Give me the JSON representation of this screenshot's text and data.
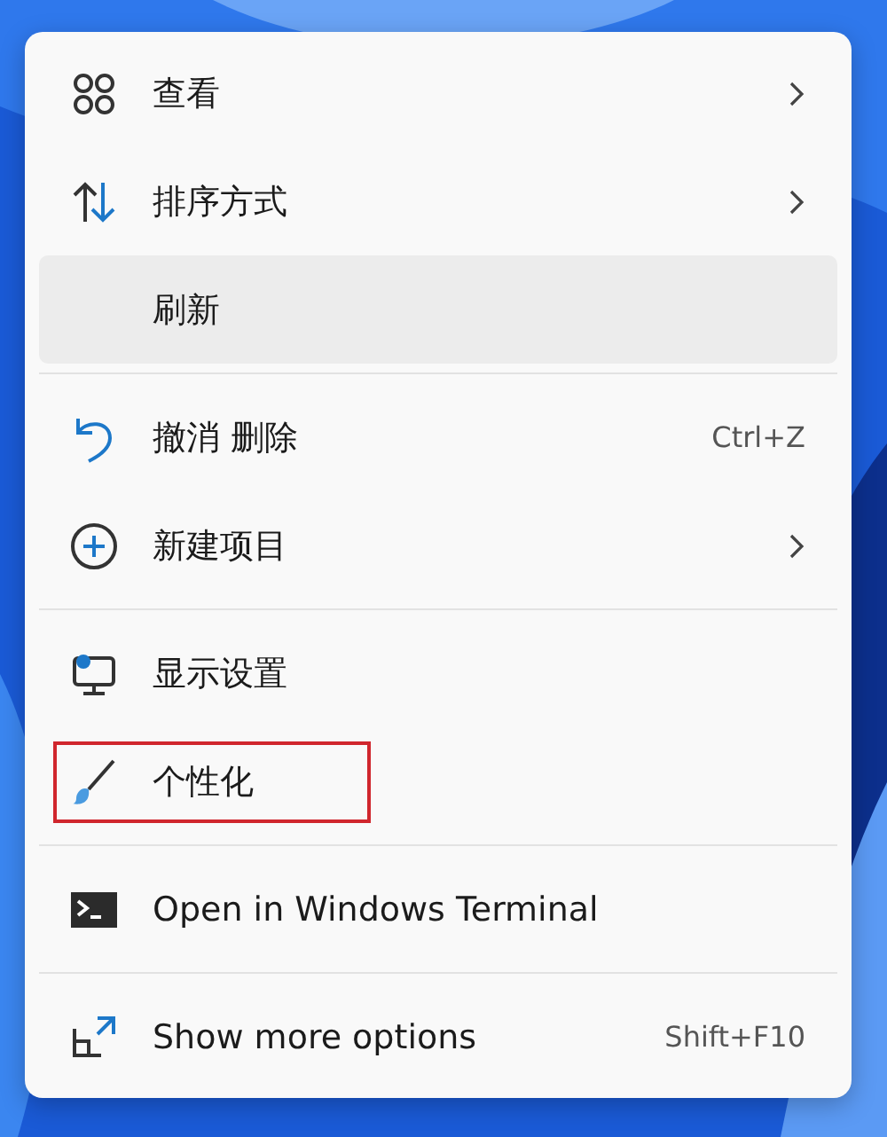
{
  "menu": {
    "groups": [
      {
        "items": [
          {
            "label": "查看",
            "submenu": true,
            "selected": false,
            "annotated": false
          },
          {
            "label": "排序方式",
            "submenu": true,
            "selected": false,
            "annotated": false
          },
          {
            "label": "刷新",
            "submenu": false,
            "selected": true,
            "annotated": false
          }
        ]
      },
      {
        "items": [
          {
            "label": "撤消 删除",
            "shortcut": "Ctrl+Z",
            "submenu": false,
            "selected": false,
            "annotated": false
          },
          {
            "label": "新建项目",
            "submenu": true,
            "selected": false,
            "annotated": false
          }
        ]
      },
      {
        "items": [
          {
            "label": "显示设置",
            "submenu": false,
            "selected": false,
            "annotated": false
          },
          {
            "label": "个性化",
            "submenu": false,
            "selected": false,
            "annotated": true
          }
        ]
      },
      {
        "items": [
          {
            "label": "Open in Windows Terminal",
            "submenu": false,
            "selected": false,
            "annotated": false
          }
        ]
      },
      {
        "items": [
          {
            "label": "Show more options",
            "shortcut": "Shift+F10",
            "submenu": false,
            "selected": false,
            "annotated": false
          }
        ]
      }
    ]
  }
}
